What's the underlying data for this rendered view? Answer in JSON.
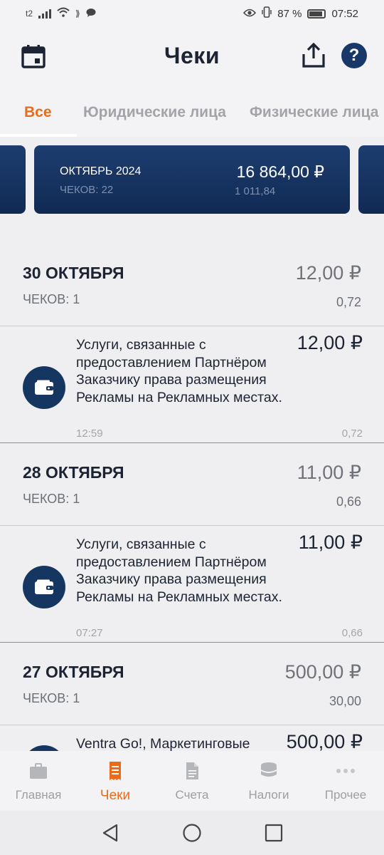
{
  "status": {
    "carrier": "t2",
    "battery": "87 %",
    "time": "07:52"
  },
  "header": {
    "title": "Чеки",
    "help": "?"
  },
  "tabs": [
    {
      "label": "Все",
      "active": true
    },
    {
      "label": "Юридические лица",
      "active": false
    },
    {
      "label": "Физические лица",
      "active": false
    }
  ],
  "summary": {
    "month": "ОКТЯБРЬ 2024",
    "count": "ЧЕКОВ: 22",
    "sum": "16 864,00 ₽",
    "sub": "1 011,84"
  },
  "days": [
    {
      "date": "30 ОКТЯБРЯ",
      "count": "ЧЕКОВ: 1",
      "amount": "12,00 ₽",
      "commission": "0,72",
      "receipt": {
        "desc": "Услуги, связанные с предоставлением Партнёром Заказчику права размещения Рекламы на Рекламных местах.",
        "amount": "12,00 ₽",
        "time": "12:59",
        "commission": "0,72"
      }
    },
    {
      "date": "28 ОКТЯБРЯ",
      "count": "ЧЕКОВ: 1",
      "amount": "11,00 ₽",
      "commission": "0,66",
      "receipt": {
        "desc": "Услуги, связанные с предоставлением Партнёром Заказчику права размещения Рекламы на Рекламных местах.",
        "amount": "11,00 ₽",
        "time": "07:27",
        "commission": "0,66"
      }
    },
    {
      "date": "27 ОКТЯБРЯ",
      "count": "ЧЕКОВ: 1",
      "amount": "500,00 ₽",
      "commission": "30,00",
      "receipt": {
        "desc": "Ventra Go!, Маркетинговые",
        "amount": "500,00 ₽",
        "time": "",
        "commission": ""
      }
    }
  ],
  "nav": [
    {
      "label": "Главная",
      "icon": "briefcase-icon",
      "active": false
    },
    {
      "label": "Чеки",
      "icon": "receipt-icon",
      "active": true
    },
    {
      "label": "Счета",
      "icon": "document-icon",
      "active": false
    },
    {
      "label": "Налоги",
      "icon": "coins-icon",
      "active": false
    },
    {
      "label": "Прочее",
      "icon": "more-icon",
      "active": false
    }
  ],
  "colors": {
    "accent": "#ec6b1a",
    "brand": "#163662"
  }
}
